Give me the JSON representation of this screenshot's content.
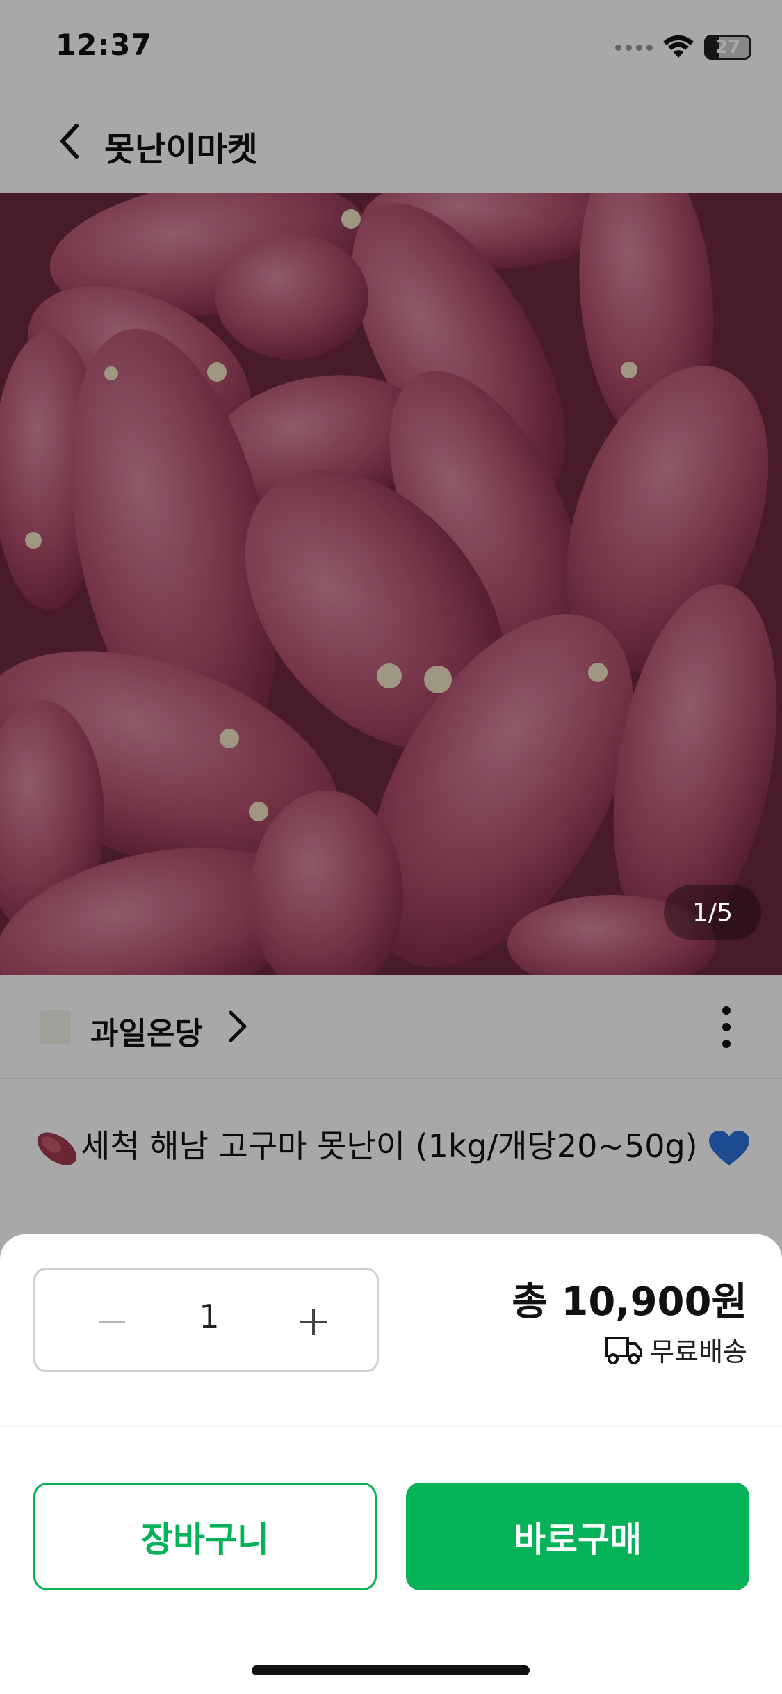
{
  "status_bar": {
    "time": "12:37",
    "battery": "27"
  },
  "nav": {
    "title": "못난이마켓",
    "back_icon": "chevron-left-icon"
  },
  "hero": {
    "page_indicator": "1/5",
    "image": "purple sweet potatoes photo"
  },
  "seller": {
    "name": "과일온당",
    "chevron_icon": "chevron-right-icon",
    "more_icon": "more-vertical-icon"
  },
  "product": {
    "title": "세척 해남 고구마 못난이 (1kg/개당20~50g)",
    "leading_emoji": "sweet-potato-icon",
    "trailing_emoji": "blue-heart-icon"
  },
  "sheet": {
    "quantity": "1",
    "total_price": "총 10,900원",
    "shipping": "무료배송",
    "cart_button": "장바구니",
    "buy_button": "바로구매"
  },
  "colors": {
    "accent": "#06b257",
    "overlay": "rgba(0,0,0,0.34)"
  }
}
